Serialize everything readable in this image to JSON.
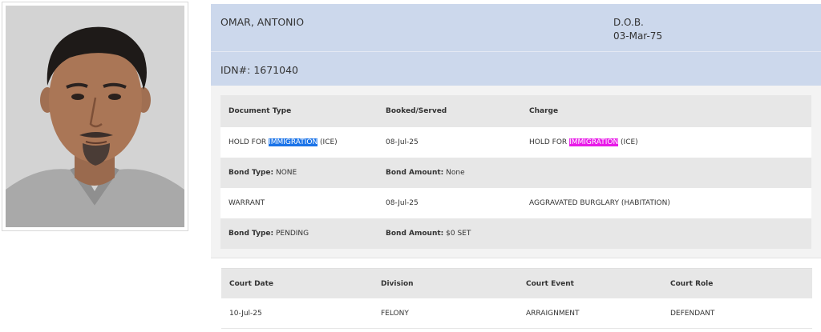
{
  "person": {
    "name": "OMAR, ANTONIO",
    "dob_label": "D.O.B.",
    "dob": "03-Mar-75",
    "idn": "IDN#: 1671040"
  },
  "documents": {
    "headers": {
      "doc_type": "Document Type",
      "booked": "Booked/Served",
      "charge": "Charge"
    },
    "items": [
      {
        "doc_type_prefix": "HOLD FOR ",
        "doc_type_highlight": "IMMIGRATION",
        "doc_type_suffix": " (ICE)",
        "booked": "08-Jul-25",
        "charge_prefix": "HOLD FOR ",
        "charge_highlight": "IMMIGRATION",
        "charge_suffix": " (ICE)",
        "bond_type_label": "Bond Type:",
        "bond_type": " NONE",
        "bond_amount_label": "Bond Amount:",
        "bond_amount": " None"
      },
      {
        "doc_type": "WARRANT",
        "booked": "08-Jul-25",
        "charge": "AGGRAVATED BURGLARY (HABITATION)",
        "bond_type_label": "Bond Type:",
        "bond_type": " PENDING",
        "bond_amount_label": "Bond Amount:",
        "bond_amount": " $0 SET"
      }
    ]
  },
  "court": {
    "headers": {
      "date": "Court Date",
      "division": "Division",
      "event": "Court Event",
      "role": "Court Role"
    },
    "rows": [
      {
        "date": "10-Jul-25",
        "division": "FELONY",
        "event": "ARRAIGNMENT",
        "role": "DEFENDANT"
      }
    ]
  },
  "colors": {
    "header_bg": "#ccd8ec",
    "highlight_blue": "#1a73e8",
    "highlight_magenta": "#e81ae8"
  }
}
